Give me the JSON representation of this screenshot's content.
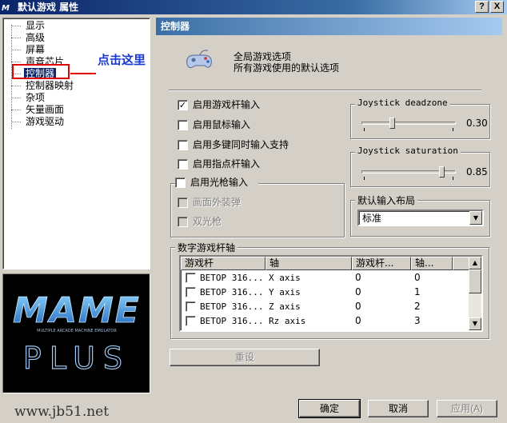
{
  "window": {
    "title": "默认游戏 属性",
    "app_icon_text": "M",
    "help_button": "?",
    "close_button": "X"
  },
  "tree": {
    "items": [
      {
        "label": "显示"
      },
      {
        "label": "高级"
      },
      {
        "label": "屏幕"
      },
      {
        "label": "声音芯片"
      },
      {
        "label": "控制器",
        "selected": true
      },
      {
        "label": "控制器映射"
      },
      {
        "label": "杂项"
      },
      {
        "label": "矢量画面"
      },
      {
        "label": "游戏驱动"
      }
    ],
    "annotation": "点击这里"
  },
  "logo": {
    "text_top": "MAME",
    "subtitle": "MULTIPLE ARCADE MACHINE EMULATOR",
    "text_bottom": "PLUS"
  },
  "panel": {
    "header": "控制器",
    "desc_title": "全局游戏选项",
    "desc_subtitle": "所有游戏使用的默认选项",
    "checkboxes": [
      {
        "label": "启用游戏杆输入",
        "checked": true
      },
      {
        "label": "启用鼠标输入",
        "checked": false
      },
      {
        "label": "启用多键同时输入支持",
        "checked": false
      },
      {
        "label": "启用指点杆输入",
        "checked": false
      }
    ],
    "lightgun": {
      "label": "启用光枪输入",
      "checked": false,
      "options": [
        {
          "label": "画面外装弹",
          "checked": false
        },
        {
          "label": "双光枪",
          "checked": false
        }
      ]
    },
    "deadzone": {
      "title": "Joystick deadzone",
      "value_text": "0.30",
      "value": 0.3
    },
    "saturation": {
      "title": "Joystick saturation",
      "value_text": "0.85",
      "value": 0.85
    },
    "layout": {
      "title": "默认输入布局",
      "selected": "标准",
      "arrow": "▼"
    },
    "axes": {
      "title": "数字游戏杆轴",
      "columns": [
        "游戏杆",
        "轴",
        "游戏杆...",
        "轴..."
      ],
      "rows": [
        {
          "joystick": "BETOP 316...",
          "axis": "X axis",
          "joy_num": "0",
          "axis_num": "0"
        },
        {
          "joystick": "BETOP 316...",
          "axis": "Y axis",
          "joy_num": "0",
          "axis_num": "1"
        },
        {
          "joystick": "BETOP 316...",
          "axis": "Z axis",
          "joy_num": "0",
          "axis_num": "2"
        },
        {
          "joystick": "BETOP 316...",
          "axis": "Rz axis",
          "joy_num": "0",
          "axis_num": "3"
        }
      ]
    },
    "reset_button": "重设"
  },
  "footer": {
    "ok": "确定",
    "cancel": "取消",
    "apply": "应用(A)"
  },
  "watermark": "www.jb51.net",
  "colors": {
    "titlebar_start": "#0a246a",
    "titlebar_end": "#a6caf0",
    "face": "#d4d0c8",
    "annotation_red": "#e00000",
    "annotation_blue": "#1a3ad0"
  }
}
